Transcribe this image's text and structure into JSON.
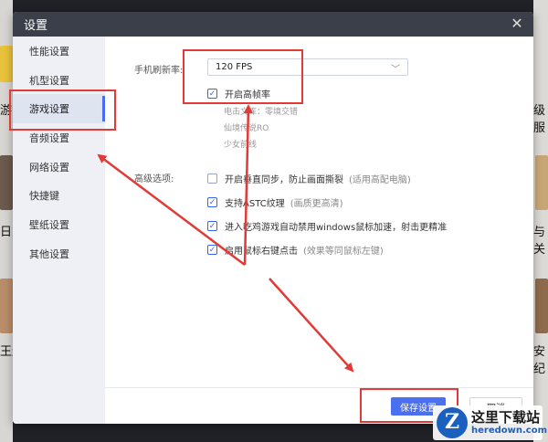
{
  "dialog": {
    "title": "设置",
    "close_symbol": "✕"
  },
  "sidebar": {
    "items": [
      {
        "label": "性能设置"
      },
      {
        "label": "机型设置"
      },
      {
        "label": "游戏设置",
        "active": true
      },
      {
        "label": "音频设置"
      },
      {
        "label": "网络设置"
      },
      {
        "label": "快捷键"
      },
      {
        "label": "壁纸设置"
      },
      {
        "label": "其他设置"
      }
    ]
  },
  "refresh": {
    "label": "手机刷新率:",
    "value": "120 FPS",
    "high_frame_checkbox": {
      "label": "开启高帧率",
      "checked": true
    },
    "supported_games": [
      "电击文库：零境交错",
      "仙境传说RO",
      "少女前线"
    ]
  },
  "advanced": {
    "label": "高级选项:",
    "options": [
      {
        "label": "开启垂直同步，防止画面撕裂",
        "hint": "(适用高配电脑)",
        "checked": false
      },
      {
        "label": "支持ASTC纹理",
        "hint": "(画质更高清)",
        "checked": true
      },
      {
        "label": "进入吃鸡游戏自动禁用windows鼠标加速，射击更精准",
        "hint": "",
        "checked": true
      },
      {
        "label": "启用鼠标右键点击",
        "hint": "(效果等同鼠标左键)",
        "checked": true
      }
    ]
  },
  "footer": {
    "save_label": "保存设置",
    "cancel_label": "取消"
  },
  "background": {
    "left_fragments": [
      "游",
      "日方",
      "王连"
    ],
    "right_fragments": [
      "级服",
      "与关",
      "安纪"
    ]
  },
  "watermark": {
    "cn": "这里下载站",
    "en": "heredown.com"
  },
  "colors": {
    "accent": "#4a6ff0",
    "annotation": "#e23a36",
    "titlebar": "#3b3f4a",
    "sidebar_bg": "#eef0f5"
  }
}
